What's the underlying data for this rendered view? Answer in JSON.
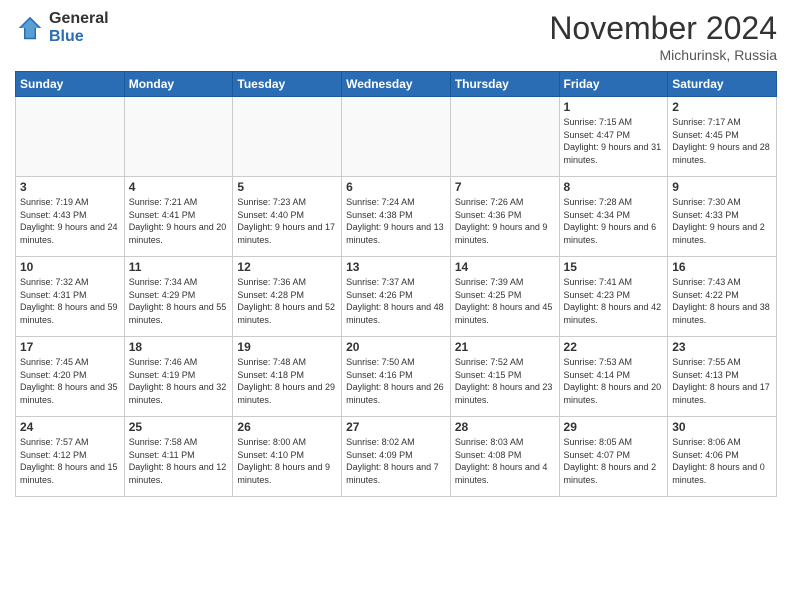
{
  "logo": {
    "general": "General",
    "blue": "Blue"
  },
  "header": {
    "title": "November 2024",
    "location": "Michurinsk, Russia"
  },
  "weekdays": [
    "Sunday",
    "Monday",
    "Tuesday",
    "Wednesday",
    "Thursday",
    "Friday",
    "Saturday"
  ],
  "weeks": [
    [
      {
        "day": "",
        "sunrise": "",
        "sunset": "",
        "daylight": ""
      },
      {
        "day": "",
        "sunrise": "",
        "sunset": "",
        "daylight": ""
      },
      {
        "day": "",
        "sunrise": "",
        "sunset": "",
        "daylight": ""
      },
      {
        "day": "",
        "sunrise": "",
        "sunset": "",
        "daylight": ""
      },
      {
        "day": "",
        "sunrise": "",
        "sunset": "",
        "daylight": ""
      },
      {
        "day": "1",
        "sunrise": "Sunrise: 7:15 AM",
        "sunset": "Sunset: 4:47 PM",
        "daylight": "Daylight: 9 hours and 31 minutes."
      },
      {
        "day": "2",
        "sunrise": "Sunrise: 7:17 AM",
        "sunset": "Sunset: 4:45 PM",
        "daylight": "Daylight: 9 hours and 28 minutes."
      }
    ],
    [
      {
        "day": "3",
        "sunrise": "Sunrise: 7:19 AM",
        "sunset": "Sunset: 4:43 PM",
        "daylight": "Daylight: 9 hours and 24 minutes."
      },
      {
        "day": "4",
        "sunrise": "Sunrise: 7:21 AM",
        "sunset": "Sunset: 4:41 PM",
        "daylight": "Daylight: 9 hours and 20 minutes."
      },
      {
        "day": "5",
        "sunrise": "Sunrise: 7:23 AM",
        "sunset": "Sunset: 4:40 PM",
        "daylight": "Daylight: 9 hours and 17 minutes."
      },
      {
        "day": "6",
        "sunrise": "Sunrise: 7:24 AM",
        "sunset": "Sunset: 4:38 PM",
        "daylight": "Daylight: 9 hours and 13 minutes."
      },
      {
        "day": "7",
        "sunrise": "Sunrise: 7:26 AM",
        "sunset": "Sunset: 4:36 PM",
        "daylight": "Daylight: 9 hours and 9 minutes."
      },
      {
        "day": "8",
        "sunrise": "Sunrise: 7:28 AM",
        "sunset": "Sunset: 4:34 PM",
        "daylight": "Daylight: 9 hours and 6 minutes."
      },
      {
        "day": "9",
        "sunrise": "Sunrise: 7:30 AM",
        "sunset": "Sunset: 4:33 PM",
        "daylight": "Daylight: 9 hours and 2 minutes."
      }
    ],
    [
      {
        "day": "10",
        "sunrise": "Sunrise: 7:32 AM",
        "sunset": "Sunset: 4:31 PM",
        "daylight": "Daylight: 8 hours and 59 minutes."
      },
      {
        "day": "11",
        "sunrise": "Sunrise: 7:34 AM",
        "sunset": "Sunset: 4:29 PM",
        "daylight": "Daylight: 8 hours and 55 minutes."
      },
      {
        "day": "12",
        "sunrise": "Sunrise: 7:36 AM",
        "sunset": "Sunset: 4:28 PM",
        "daylight": "Daylight: 8 hours and 52 minutes."
      },
      {
        "day": "13",
        "sunrise": "Sunrise: 7:37 AM",
        "sunset": "Sunset: 4:26 PM",
        "daylight": "Daylight: 8 hours and 48 minutes."
      },
      {
        "day": "14",
        "sunrise": "Sunrise: 7:39 AM",
        "sunset": "Sunset: 4:25 PM",
        "daylight": "Daylight: 8 hours and 45 minutes."
      },
      {
        "day": "15",
        "sunrise": "Sunrise: 7:41 AM",
        "sunset": "Sunset: 4:23 PM",
        "daylight": "Daylight: 8 hours and 42 minutes."
      },
      {
        "day": "16",
        "sunrise": "Sunrise: 7:43 AM",
        "sunset": "Sunset: 4:22 PM",
        "daylight": "Daylight: 8 hours and 38 minutes."
      }
    ],
    [
      {
        "day": "17",
        "sunrise": "Sunrise: 7:45 AM",
        "sunset": "Sunset: 4:20 PM",
        "daylight": "Daylight: 8 hours and 35 minutes."
      },
      {
        "day": "18",
        "sunrise": "Sunrise: 7:46 AM",
        "sunset": "Sunset: 4:19 PM",
        "daylight": "Daylight: 8 hours and 32 minutes."
      },
      {
        "day": "19",
        "sunrise": "Sunrise: 7:48 AM",
        "sunset": "Sunset: 4:18 PM",
        "daylight": "Daylight: 8 hours and 29 minutes."
      },
      {
        "day": "20",
        "sunrise": "Sunrise: 7:50 AM",
        "sunset": "Sunset: 4:16 PM",
        "daylight": "Daylight: 8 hours and 26 minutes."
      },
      {
        "day": "21",
        "sunrise": "Sunrise: 7:52 AM",
        "sunset": "Sunset: 4:15 PM",
        "daylight": "Daylight: 8 hours and 23 minutes."
      },
      {
        "day": "22",
        "sunrise": "Sunrise: 7:53 AM",
        "sunset": "Sunset: 4:14 PM",
        "daylight": "Daylight: 8 hours and 20 minutes."
      },
      {
        "day": "23",
        "sunrise": "Sunrise: 7:55 AM",
        "sunset": "Sunset: 4:13 PM",
        "daylight": "Daylight: 8 hours and 17 minutes."
      }
    ],
    [
      {
        "day": "24",
        "sunrise": "Sunrise: 7:57 AM",
        "sunset": "Sunset: 4:12 PM",
        "daylight": "Daylight: 8 hours and 15 minutes."
      },
      {
        "day": "25",
        "sunrise": "Sunrise: 7:58 AM",
        "sunset": "Sunset: 4:11 PM",
        "daylight": "Daylight: 8 hours and 12 minutes."
      },
      {
        "day": "26",
        "sunrise": "Sunrise: 8:00 AM",
        "sunset": "Sunset: 4:10 PM",
        "daylight": "Daylight: 8 hours and 9 minutes."
      },
      {
        "day": "27",
        "sunrise": "Sunrise: 8:02 AM",
        "sunset": "Sunset: 4:09 PM",
        "daylight": "Daylight: 8 hours and 7 minutes."
      },
      {
        "day": "28",
        "sunrise": "Sunrise: 8:03 AM",
        "sunset": "Sunset: 4:08 PM",
        "daylight": "Daylight: 8 hours and 4 minutes."
      },
      {
        "day": "29",
        "sunrise": "Sunrise: 8:05 AM",
        "sunset": "Sunset: 4:07 PM",
        "daylight": "Daylight: 8 hours and 2 minutes."
      },
      {
        "day": "30",
        "sunrise": "Sunrise: 8:06 AM",
        "sunset": "Sunset: 4:06 PM",
        "daylight": "Daylight: 8 hours and 0 minutes."
      }
    ]
  ]
}
